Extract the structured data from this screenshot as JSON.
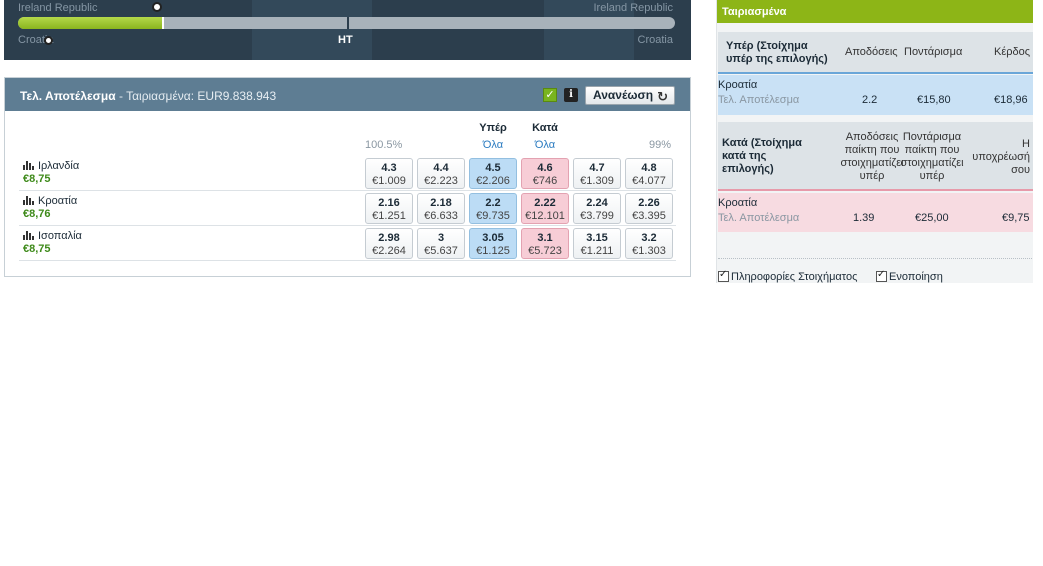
{
  "tracker": {
    "team_home_top": "Ireland Republic",
    "team_home_top_right": "Ireland Republic",
    "team_away_bottom_left": "Croatia",
    "team_away_bottom_right": "Croatia",
    "ht_label": "HT",
    "progress_fraction": 0.22,
    "ht_fraction": 0.5,
    "colors": {
      "background": "#2c3e4d",
      "progress": "#8ab51e",
      "track": "#a8b2ba"
    }
  },
  "market": {
    "title": "Τελ. Αποτέλεσμα",
    "matched_prefix": " - Ταιριασμένα: ",
    "matched_amount": "EUR9.838.943",
    "refresh_label": "Ανανέωση",
    "refresh_icon": "refresh-icon",
    "book_back": "100.5%",
    "book_lay": "99%",
    "back_header": "Υπέρ",
    "lay_header": "Κατά",
    "back_all": "Όλα",
    "lay_all": "Όλα",
    "colors": {
      "header": "#5e7d93",
      "back": "#bcdcf5",
      "lay": "#f7cdd6",
      "pl": "#3e8a1a"
    },
    "runners": [
      {
        "name": "Ιρλανδία",
        "pl": "€8,75",
        "prices": [
          {
            "odds": "4.3",
            "amount": "€1.009",
            "type": "back3"
          },
          {
            "odds": "4.4",
            "amount": "€2.223",
            "type": "back2"
          },
          {
            "odds": "4.5",
            "amount": "€2.206",
            "type": "back"
          },
          {
            "odds": "4.6",
            "amount": "€746",
            "type": "lay"
          },
          {
            "odds": "4.7",
            "amount": "€1.309",
            "type": "lay2"
          },
          {
            "odds": "4.8",
            "amount": "€4.077",
            "type": "lay3"
          }
        ]
      },
      {
        "name": "Κροατία",
        "pl": "€8,76",
        "prices": [
          {
            "odds": "2.16",
            "amount": "€1.251",
            "type": "back3"
          },
          {
            "odds": "2.18",
            "amount": "€6.633",
            "type": "back2"
          },
          {
            "odds": "2.2",
            "amount": "€9.735",
            "type": "back"
          },
          {
            "odds": "2.22",
            "amount": "€12.101",
            "type": "lay"
          },
          {
            "odds": "2.24",
            "amount": "€3.799",
            "type": "lay2"
          },
          {
            "odds": "2.26",
            "amount": "€3.395",
            "type": "lay3"
          }
        ]
      },
      {
        "name": "Ισοπαλία",
        "pl": "€8,75",
        "prices": [
          {
            "odds": "2.98",
            "amount": "€2.264",
            "type": "back3"
          },
          {
            "odds": "3",
            "amount": "€5.637",
            "type": "back2"
          },
          {
            "odds": "3.05",
            "amount": "€1.125",
            "type": "back"
          },
          {
            "odds": "3.1",
            "amount": "€5.723",
            "type": "lay"
          },
          {
            "odds": "3.15",
            "amount": "€1.211",
            "type": "lay2"
          },
          {
            "odds": "3.2",
            "amount": "€1.303",
            "type": "lay3"
          }
        ]
      }
    ]
  },
  "slip": {
    "header": "Ταιριασμένα",
    "back_section": {
      "title_line1": "Υπέρ (Στοίχημα",
      "title_line2": "υπέρ της επιλογής)",
      "col_odds": "Αποδόσεις",
      "col_stake": "Ποντάρισμα",
      "col_profit": "Κέρδος"
    },
    "back_bet": {
      "runner": "Κροατία",
      "market": "Τελ. Αποτέλεσμα",
      "odds": "2.2",
      "stake": "€15,80",
      "profit": "€18,96"
    },
    "lay_section": {
      "title_line1": "Κατά (Στοίχημα",
      "title_line2": "κατά της",
      "title_line3": "επιλογής)",
      "col_odds_1": "Αποδόσεις",
      "col_odds_2": "παίκτη που",
      "col_odds_3": "στοιχηματίζει",
      "col_odds_4": "υπέρ",
      "col_stake_1": "Ποντάρισμα",
      "col_stake_2": "παίκτη που",
      "col_stake_3": "στοιχηματίζει",
      "col_stake_4": "υπέρ",
      "col_liab_1": "Η",
      "col_liab_2": "υποχρέωσή",
      "col_liab_3": "σου"
    },
    "lay_bet": {
      "runner": "Κροατία",
      "market": "Τελ. Αποτέλεσμα",
      "odds": "1.39",
      "stake": "€25,00",
      "liability": "€9,75"
    },
    "option_info": "Πληροφορίες Στοιχήματος",
    "option_consolidate": "Ενοποίηση",
    "colors": {
      "header": "#8db517",
      "back_row": "#c9e1f5",
      "lay_row": "#f7dbe1"
    }
  }
}
